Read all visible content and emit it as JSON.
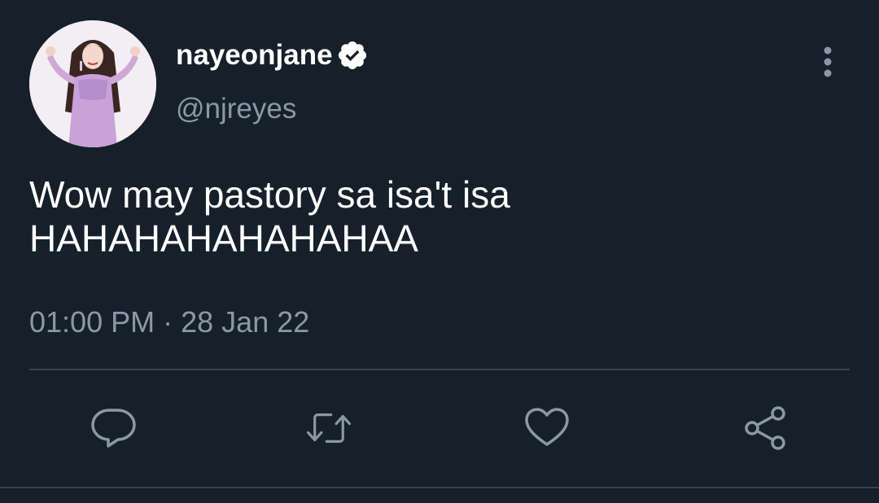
{
  "tweet": {
    "author": {
      "display_name": "nayeonjane",
      "handle": "@njreyes",
      "verified": true,
      "avatar": "avatar-photo"
    },
    "text_lines": [
      "Wow may pastory sa isa't isa",
      "HAHAHAHAHAHAHAA"
    ],
    "time": "01:00 PM",
    "separator": "·",
    "date": "28 Jan 22"
  },
  "actions": [
    {
      "name": "reply",
      "icon": "reply-icon"
    },
    {
      "name": "retweet",
      "icon": "retweet-icon"
    },
    {
      "name": "like",
      "icon": "heart-icon"
    },
    {
      "name": "share",
      "icon": "share-icon"
    }
  ],
  "colors": {
    "background": "#15202b",
    "text": "#ffffff",
    "secondary_text": "#8b98a5",
    "divider": "#38444d"
  }
}
